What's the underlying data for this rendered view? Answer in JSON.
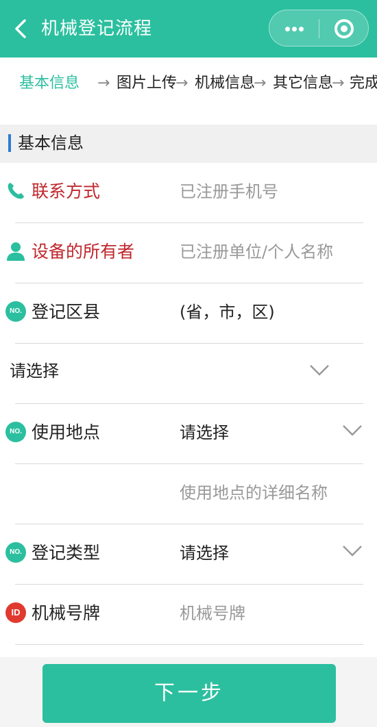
{
  "header": {
    "title": "机械登记流程"
  },
  "steps": {
    "s1": "基本信息",
    "s2": "图片上传",
    "s3": "机械信息",
    "s4": "其它信息",
    "s5": "完成",
    "arrow": "→"
  },
  "section": {
    "title": "基本信息"
  },
  "form": {
    "contact": {
      "label": "联系方式",
      "placeholder": "已注册手机号"
    },
    "owner": {
      "label": "设备的所有者",
      "placeholder": "已注册单位/个人名称"
    },
    "district": {
      "label": "登记区县",
      "value": "(省，市，区)",
      "select": "请选择"
    },
    "location": {
      "label": "使用地点",
      "select": "请选择",
      "detail_placeholder": "使用地点的详细名称"
    },
    "reg_type": {
      "label": "登记类型",
      "select": "请选择"
    },
    "plate": {
      "label": "机械号牌",
      "placeholder": "机械号牌"
    }
  },
  "badges": {
    "no": "NO.",
    "id": "ID"
  },
  "footer": {
    "next_label": "下一步"
  },
  "colors": {
    "primary": "#2bbf9f",
    "required": "#c0262c",
    "section_bar": "#2b7cd3"
  }
}
